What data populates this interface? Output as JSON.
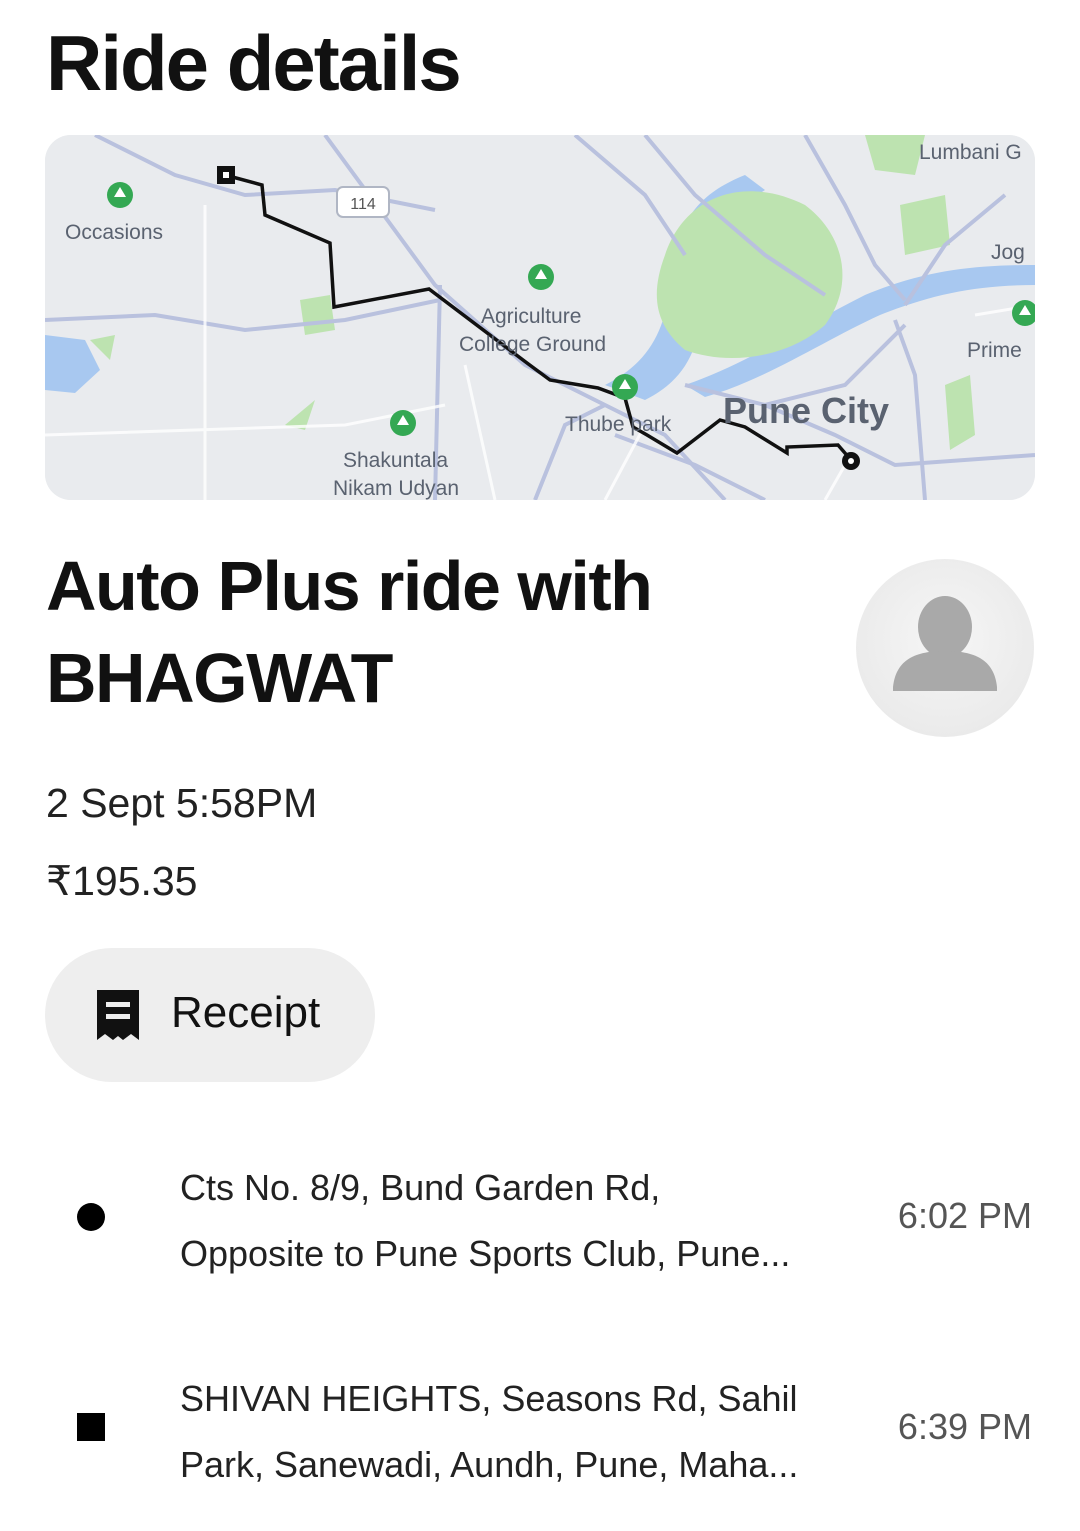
{
  "header": {
    "title": "Ride details"
  },
  "map": {
    "labels": {
      "occasions": "Occasions",
      "road_shield": "114",
      "agriculture_1": "Agriculture",
      "agriculture_2": "College Ground",
      "thube_park": "Thube park",
      "pune_city": "Pune City",
      "shakuntala_1": "Shakuntala",
      "shakuntala_2": "Nikam Udyan",
      "lumbani": "Lumbani G",
      "jog": "Jog",
      "prime": "Prime"
    },
    "colors": {
      "route": "#111111",
      "water": "#a8c8f0",
      "park": "#bde3b0",
      "road": "#b9c1de",
      "background": "#e9ebee"
    }
  },
  "ride": {
    "title_line1": "Auto Plus ride with",
    "title_line2": "BHAGWAT",
    "date": "2 Sept 5:58PM",
    "price": "₹195.35"
  },
  "actions": {
    "receipt_label": "Receipt"
  },
  "stops": [
    {
      "type": "pickup",
      "address_line1": "Cts No. 8/9, Bund Garden Rd,",
      "address_line2": "Opposite to Pune Sports Club, Pune...",
      "time": "6:02 PM"
    },
    {
      "type": "dropoff",
      "address_line1": "SHIVAN HEIGHTS, Seasons Rd, Sahil",
      "address_line2": "Park, Sanewadi, Aundh, Pune, Maha...",
      "time": "6:39 PM"
    }
  ],
  "icons": {
    "receipt": "receipt-icon",
    "avatar": "person-silhouette-icon",
    "pickup": "dot-icon",
    "dropoff": "square-icon"
  }
}
